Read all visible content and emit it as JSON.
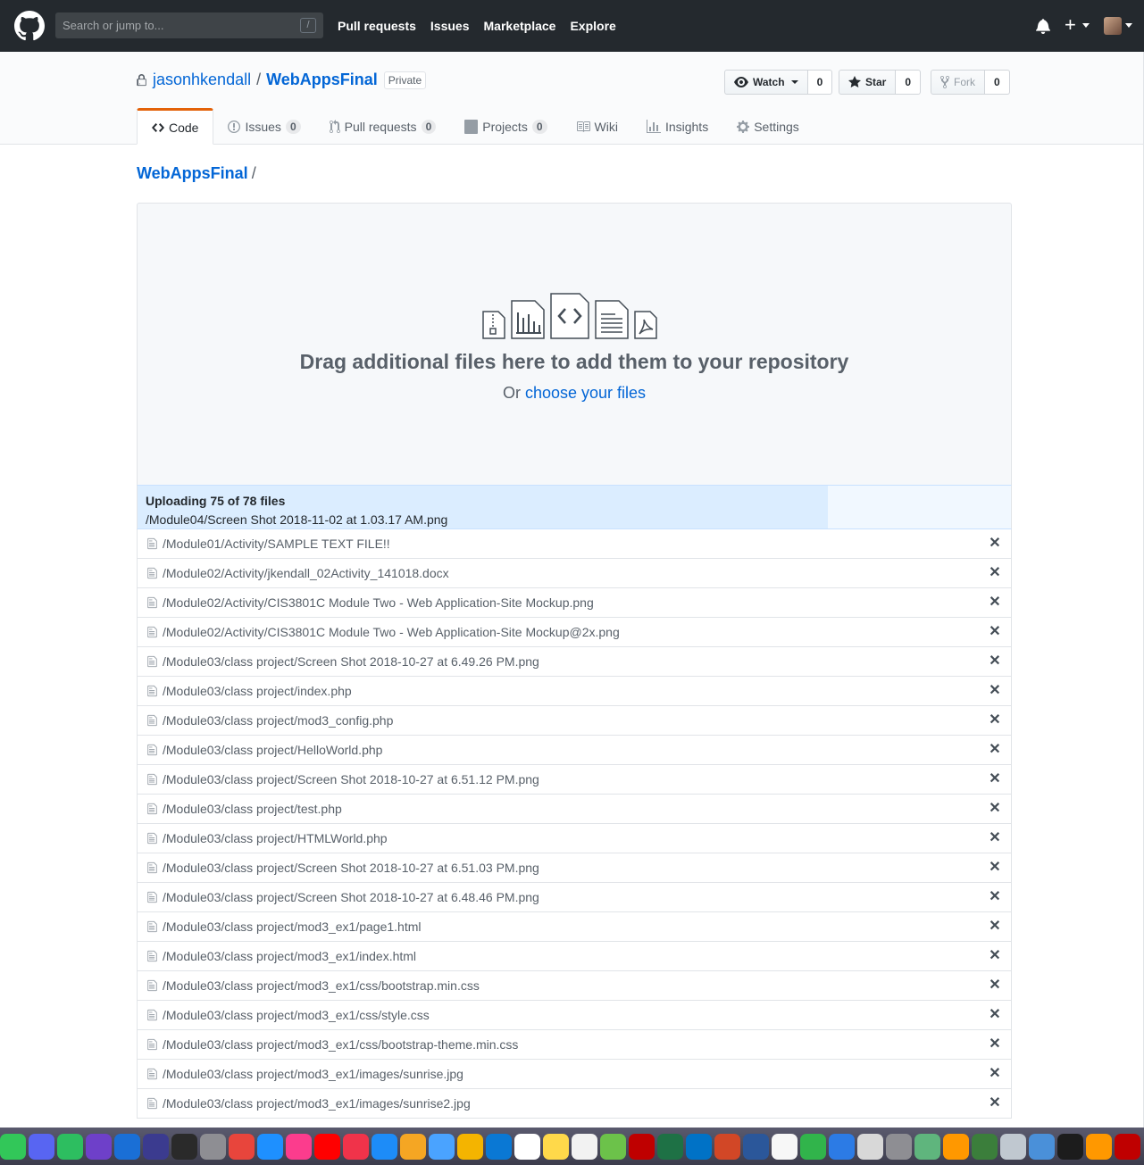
{
  "header": {
    "search_placeholder": "Search or jump to...",
    "search_shortcut": "/",
    "nav": [
      "Pull requests",
      "Issues",
      "Marketplace",
      "Explore"
    ],
    "plus": "+"
  },
  "repo": {
    "owner": "jasonhkendall",
    "separator": "/",
    "name": "WebAppsFinal",
    "visibility": "Private",
    "watch": {
      "label": "Watch",
      "count": "0"
    },
    "star": {
      "label": "Star",
      "count": "0"
    },
    "fork": {
      "label": "Fork",
      "count": "0"
    }
  },
  "tabs": [
    {
      "label": "Code",
      "icon": "code-icon"
    },
    {
      "label": "Issues",
      "count": "0",
      "icon": "issue-icon"
    },
    {
      "label": "Pull requests",
      "count": "0",
      "icon": "pull-request-icon"
    },
    {
      "label": "Projects",
      "count": "0",
      "icon": "project-icon"
    },
    {
      "label": "Wiki",
      "icon": "book-icon"
    },
    {
      "label": "Insights",
      "icon": "graph-icon"
    },
    {
      "label": "Settings",
      "icon": "gear-icon"
    }
  ],
  "breadcrumb": {
    "root": "WebAppsFinal",
    "slash": "/"
  },
  "dropzone": {
    "title": "Drag additional files here to add them to your repository",
    "sub_prefix": "Or",
    "sub_link": "choose your files"
  },
  "upload": {
    "title": "Uploading 75 of 78 files",
    "current_file": "/Module04/Screen Shot 2018-11-02 at 1.03.17 AM.png",
    "progress": 0.79
  },
  "files": [
    "/Module01/Activity/SAMPLE TEXT FILE!!",
    "/Module02/Activity/jkendall_02Activity_141018.docx",
    "/Module02/Activity/CIS3801C Module Two - Web Application-Site Mockup.png",
    "/Module02/Activity/CIS3801C Module Two - Web Application-Site Mockup@2x.png",
    "/Module03/class project/Screen Shot 2018-10-27 at 6.49.26 PM.png",
    "/Module03/class project/index.php",
    "/Module03/class project/mod3_config.php",
    "/Module03/class project/HelloWorld.php",
    "/Module03/class project/Screen Shot 2018-10-27 at 6.51.12 PM.png",
    "/Module03/class project/test.php",
    "/Module03/class project/HTMLWorld.php",
    "/Module03/class project/Screen Shot 2018-10-27 at 6.51.03 PM.png",
    "/Module03/class project/Screen Shot 2018-10-27 at 6.48.46 PM.png",
    "/Module03/class project/mod3_ex1/page1.html",
    "/Module03/class project/mod3_ex1/index.html",
    "/Module03/class project/mod3_ex1/css/bootstrap.min.css",
    "/Module03/class project/mod3_ex1/css/style.css",
    "/Module03/class project/mod3_ex1/css/bootstrap-theme.min.css",
    "/Module03/class project/mod3_ex1/images/sunrise.jpg",
    "/Module03/class project/mod3_ex1/images/sunrise2.jpg"
  ],
  "remove_glyph": "✕",
  "dock_apps": [
    {
      "name": "messages-app",
      "color": "#32c759"
    },
    {
      "name": "discord-app",
      "color": "#5865f2"
    },
    {
      "name": "evernote-app",
      "color": "#2dbe60"
    },
    {
      "name": "github-desktop-app",
      "color": "#6e40c9"
    },
    {
      "name": "1password-app",
      "color": "#1a6fd6"
    },
    {
      "name": "siri-app",
      "color": "#3b3b8f"
    },
    {
      "name": "dashboard-app",
      "color": "#2a2a2a"
    },
    {
      "name": "launchpad-app",
      "color": "#8e8e93"
    },
    {
      "name": "chrome-app",
      "color": "#e8453c"
    },
    {
      "name": "safari-app",
      "color": "#1e90ff"
    },
    {
      "name": "itunes-app",
      "color": "#fc3c8d"
    },
    {
      "name": "youtube-app",
      "color": "#ff0000"
    },
    {
      "name": "news-app",
      "color": "#f0334a"
    },
    {
      "name": "app-store-app",
      "color": "#1d8cf8"
    },
    {
      "name": "photos-app",
      "color": "#f5a623"
    },
    {
      "name": "messenger-app",
      "color": "#4aa3ff"
    },
    {
      "name": "reeder-app",
      "color": "#f4b400"
    },
    {
      "name": "onedrive-app",
      "color": "#0a78d4"
    },
    {
      "name": "calendar-app",
      "color": "#ffffff"
    },
    {
      "name": "notes-app",
      "color": "#ffd94a"
    },
    {
      "name": "reminders-app",
      "color": "#f2f2f2"
    },
    {
      "name": "maps-app",
      "color": "#6cc24a"
    },
    {
      "name": "filezilla-app",
      "color": "#bf0000"
    },
    {
      "name": "excel-app",
      "color": "#1e7145"
    },
    {
      "name": "outlook-app",
      "color": "#0072c6"
    },
    {
      "name": "powerpoint-app",
      "color": "#d24726"
    },
    {
      "name": "word-app",
      "color": "#2b579a"
    },
    {
      "name": "textedit-app",
      "color": "#f7f7f7"
    },
    {
      "name": "numbers-app",
      "color": "#31b44b"
    },
    {
      "name": "keynote-app",
      "color": "#2c7be5"
    },
    {
      "name": "preview-app",
      "color": "#d8d8d8"
    },
    {
      "name": "system-preferences-app",
      "color": "#8e8e93"
    },
    {
      "name": "atom-app",
      "color": "#5fb57d"
    },
    {
      "name": "sublime-app",
      "color": "#ff9800"
    },
    {
      "name": "anaconda-app",
      "color": "#3b7e3b"
    },
    {
      "name": "finder-window-app",
      "color": "#c0c8d0"
    },
    {
      "name": "network-app",
      "color": "#4a90d9"
    },
    {
      "name": "terminal-app",
      "color": "#1c1c1c"
    },
    {
      "name": "sublime-text-app",
      "color": "#ff9800"
    },
    {
      "name": "filezilla-pro-app",
      "color": "#bf0000"
    }
  ]
}
